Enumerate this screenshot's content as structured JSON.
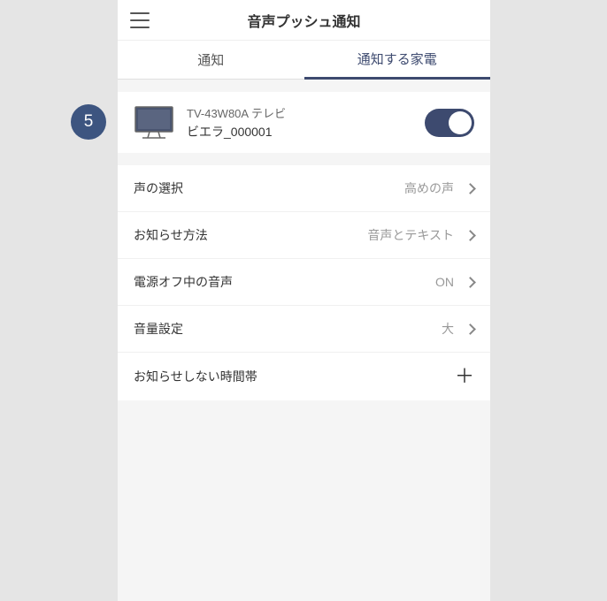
{
  "header": {
    "title": "音声プッシュ通知"
  },
  "tabs": {
    "notification": "通知",
    "devices": "通知する家電"
  },
  "device": {
    "model": "TV-43W80A テレビ",
    "name": "ビエラ_000001"
  },
  "settings": {
    "voice_selection": {
      "label": "声の選択",
      "value": "高めの声"
    },
    "notification_method": {
      "label": "お知らせ方法",
      "value": "音声とテキスト"
    },
    "audio_when_off": {
      "label": "電源オフ中の音声",
      "value": "ON"
    },
    "volume": {
      "label": "音量設定",
      "value": "大"
    },
    "quiet_hours": {
      "label": "お知らせしない時間帯"
    }
  },
  "badge": {
    "number": "5"
  }
}
